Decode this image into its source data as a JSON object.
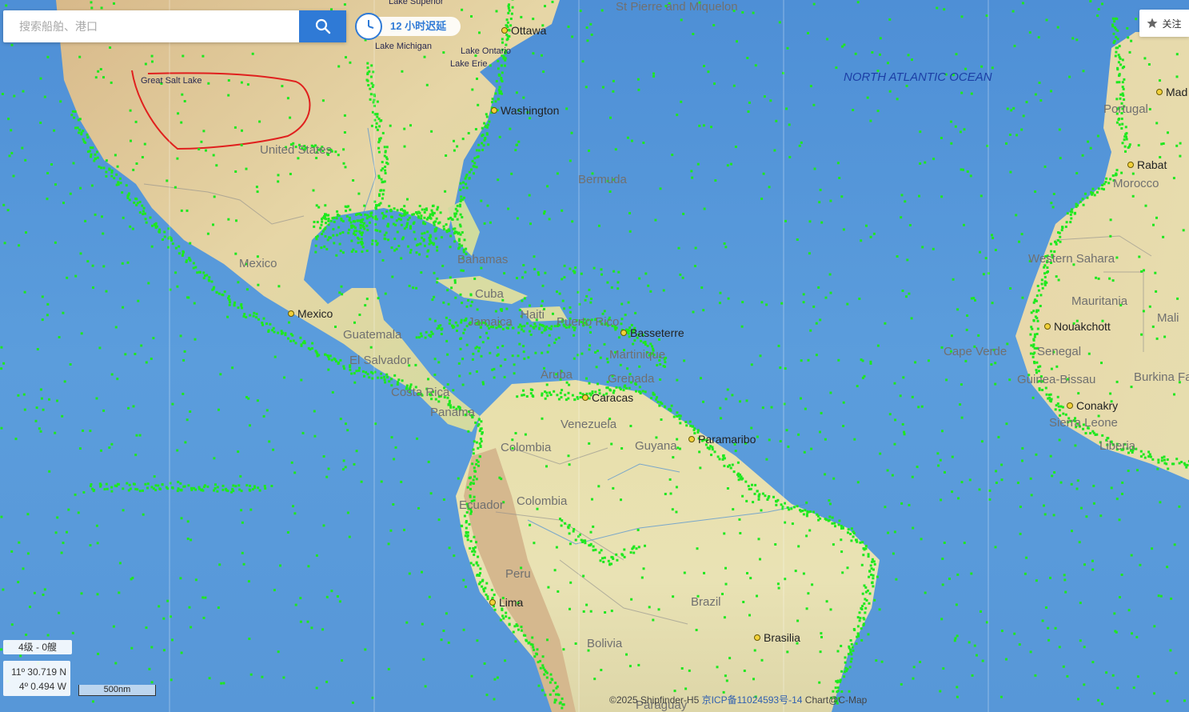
{
  "search": {
    "placeholder": "搜索船舶、港口"
  },
  "delay": {
    "label": "12 小时迟延"
  },
  "follow": {
    "label": "关注"
  },
  "status": {
    "zoom_label": "4级 - 0艘",
    "lat": "11º 30.719 N",
    "lon": "4º 0.494 W",
    "scale": "500nm"
  },
  "copyright": {
    "text": "©2025 Shipfinder-H5",
    "icp": "京ICP备11024593号-14",
    "chart": "Chart@C-Map"
  },
  "map": {
    "oceans": [
      "NORTH ATLANTIC OCEAN"
    ],
    "countries": [
      "United States",
      "Mexico",
      "Guatemala",
      "El Salvador",
      "Costa Rica",
      "Panama",
      "Cuba",
      "Haiti",
      "Jamaica",
      "Puerto Rico",
      "Martinique",
      "Grenada",
      "Aruba",
      "Venezuela",
      "Colombia",
      "Guyana",
      "Ecuador",
      "Colombia",
      "Peru",
      "Brazil",
      "Bolivia",
      "Bermuda",
      "Bahamas",
      "Portugal",
      "Morocco",
      "Western Sahara",
      "Mauritania",
      "Mali",
      "Senegal",
      "Guinea-Bissau",
      "Sierra Leone",
      "Liberia",
      "Burkina Fa",
      "Cape Verde",
      "Paraguay",
      "St Pierre and Miquelon"
    ],
    "cities": [
      "Ottawa",
      "Washington",
      "Mexico",
      "Basseterre",
      "Caracas",
      "Paramaribo",
      "Lima",
      "Brasilia",
      "Rabat",
      "Nouakchott",
      "Conakry",
      "Mad"
    ],
    "lakes": [
      "Great Salt Lake",
      "Lake Michigan",
      "Lake Ontario",
      "Lake Erie",
      "Lake Superior"
    ],
    "colors": {
      "ship": "#1ee81e",
      "annotation": "#e0201e",
      "accent": "#2f7ad6"
    }
  }
}
